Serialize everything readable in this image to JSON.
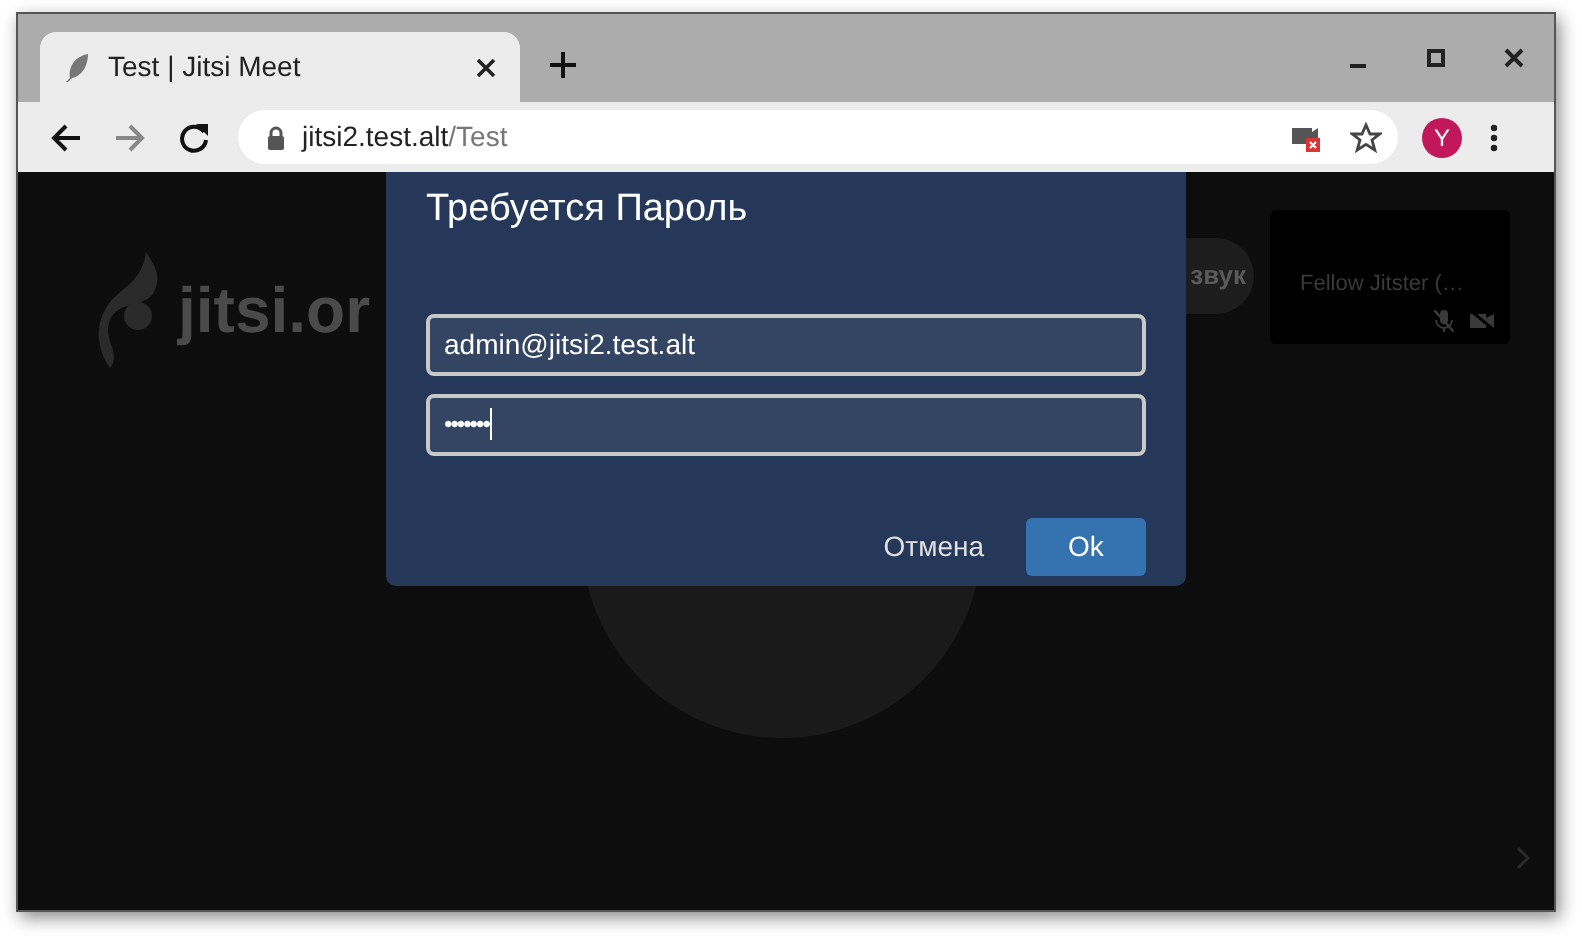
{
  "browser": {
    "tab": {
      "title": "Test | Jitsi Meet",
      "selected": true
    },
    "address": {
      "host": "jitsi2.test.alt",
      "path": "/Test"
    },
    "profile": "Y"
  },
  "conference": {
    "logo": "jitsi.or",
    "audio_pill": "звук",
    "participant_tile": {
      "name": "Fellow Jitster (…",
      "audio_muted": true,
      "video_muted": true
    }
  },
  "dialog": {
    "title": "Требуется Пароль",
    "username": "admin@jitsi2.test.alt",
    "password": "•••••••",
    "buttons": [
      {
        "label": "Отмена",
        "kind": "secondary"
      },
      {
        "label": "Ok",
        "kind": "primary"
      }
    ]
  }
}
